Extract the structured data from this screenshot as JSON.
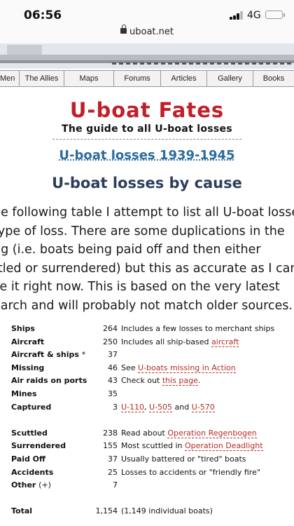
{
  "status_bar": {
    "time": "06:56",
    "network": "4G"
  },
  "browser": {
    "url": "uboat.net"
  },
  "nav": {
    "items": [
      "Men",
      "The Allies",
      "Maps",
      "Forums",
      "Articles",
      "Gallery",
      "Books"
    ]
  },
  "logo": {
    "title": "U-boat Fates",
    "subtitle": "The guide to all U-boat losses"
  },
  "page": {
    "section_link": "U-boat losses 1939-1945",
    "title": "U-boat losses by cause",
    "intro_lines": [
      "he following table I attempt to list all U-boat losses",
      "type of loss. There are some duplications in the",
      "ng (i.e. boats being paid off and then either",
      "ttled or surrendered) but this as accurate as I can",
      "ke it right now. This is based on the very latest",
      "earch and will probably not match older sources."
    ]
  },
  "table": {
    "rows": [
      {
        "cause": "Ships",
        "count": "264",
        "note": "Includes a few losses to merchant ships"
      },
      {
        "cause": "Aircraft",
        "count": "250",
        "note_prefix": "Includes all ship-based ",
        "link": "aircraft"
      },
      {
        "cause": "Aircraft & ships",
        "mark": "*",
        "count": "37"
      },
      {
        "cause": "Missing",
        "count": "46",
        "note_prefix": "See ",
        "link": "U-boats missing in Action"
      },
      {
        "cause": "Air raids on ports",
        "count": "43",
        "note_prefix": "Check out ",
        "link": "this page",
        "note_suffix": "."
      },
      {
        "cause": "Mines",
        "count": "35"
      },
      {
        "cause": "Captured",
        "count": "3",
        "links": [
          "U-110",
          "U-505",
          "U-570"
        ],
        "sep1": ", ",
        "sep2": " and "
      },
      {
        "cause": "Scuttled",
        "count": "238",
        "note_prefix": "Read about ",
        "link": "Operation Regenbogen"
      },
      {
        "cause": "Surrendered",
        "count": "155",
        "note_prefix": "Most scuttled in ",
        "link": "Operation Deadlight"
      },
      {
        "cause": "Paid Off",
        "count": "37",
        "note": "Usually battered or \"tired\" boats"
      },
      {
        "cause": "Accidents",
        "count": "25",
        "note": "Losses to accidents or \"friendly fire\""
      },
      {
        "cause": "Other",
        "mark": "(+)",
        "count": "7"
      }
    ],
    "total": {
      "cause": "Total",
      "count": "1,154",
      "note": "(1,149 individual boats)"
    }
  }
}
